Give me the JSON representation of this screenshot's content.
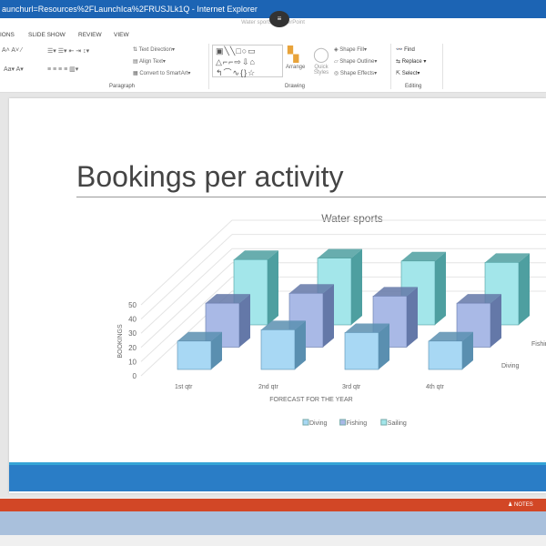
{
  "window": {
    "title": "aunchurl=Resources%2FLaunchIca%2FRUSJLk1Q - Internet Explorer",
    "doc_title": "Water sports - PowerPoint"
  },
  "tabs": [
    "IONS",
    "SLIDE SHOW",
    "REVIEW",
    "VIEW"
  ],
  "ribbon": {
    "paragraph": {
      "label": "Paragraph",
      "text_direction": "Text Direction",
      "align_text": "Align Text",
      "convert_smartart": "Convert to SmartArt"
    },
    "drawing": {
      "label": "Drawing",
      "arrange": "Arrange",
      "quick_styles": "Quick Styles",
      "shape_fill": "Shape Fill",
      "shape_outline": "Shape Outline",
      "shape_effects": "Shape Effects"
    },
    "editing": {
      "label": "Editing",
      "find": "Find",
      "replace": "Replace",
      "select": "Select"
    }
  },
  "slide": {
    "title": "Bookings per activity"
  },
  "status": {
    "notes": "NOTES"
  },
  "chart_data": {
    "type": "bar",
    "subtype": "3d-column",
    "title": "Water sports",
    "xlabel": "FORECAST FOR THE YEAR",
    "ylabel": "BOOKINGS",
    "categories": [
      "1st qtr",
      "2nd qtr",
      "3rd qtr",
      "4th qtr"
    ],
    "yticks": [
      0,
      10,
      20,
      30,
      40,
      50
    ],
    "ylim": [
      0,
      50
    ],
    "depth_labels": [
      "Diving",
      "Fishing"
    ],
    "legend_position": "bottom",
    "series": [
      {
        "name": "Diving",
        "values": [
          20,
          28,
          26,
          20
        ],
        "color": "#a8d8f4"
      },
      {
        "name": "Fishing",
        "values": [
          31,
          38,
          36,
          31
        ],
        "color": "#a9b9e6"
      },
      {
        "name": "Sailing",
        "values": [
          46,
          47,
          45,
          44
        ],
        "color": "#a3e6ea"
      }
    ]
  }
}
